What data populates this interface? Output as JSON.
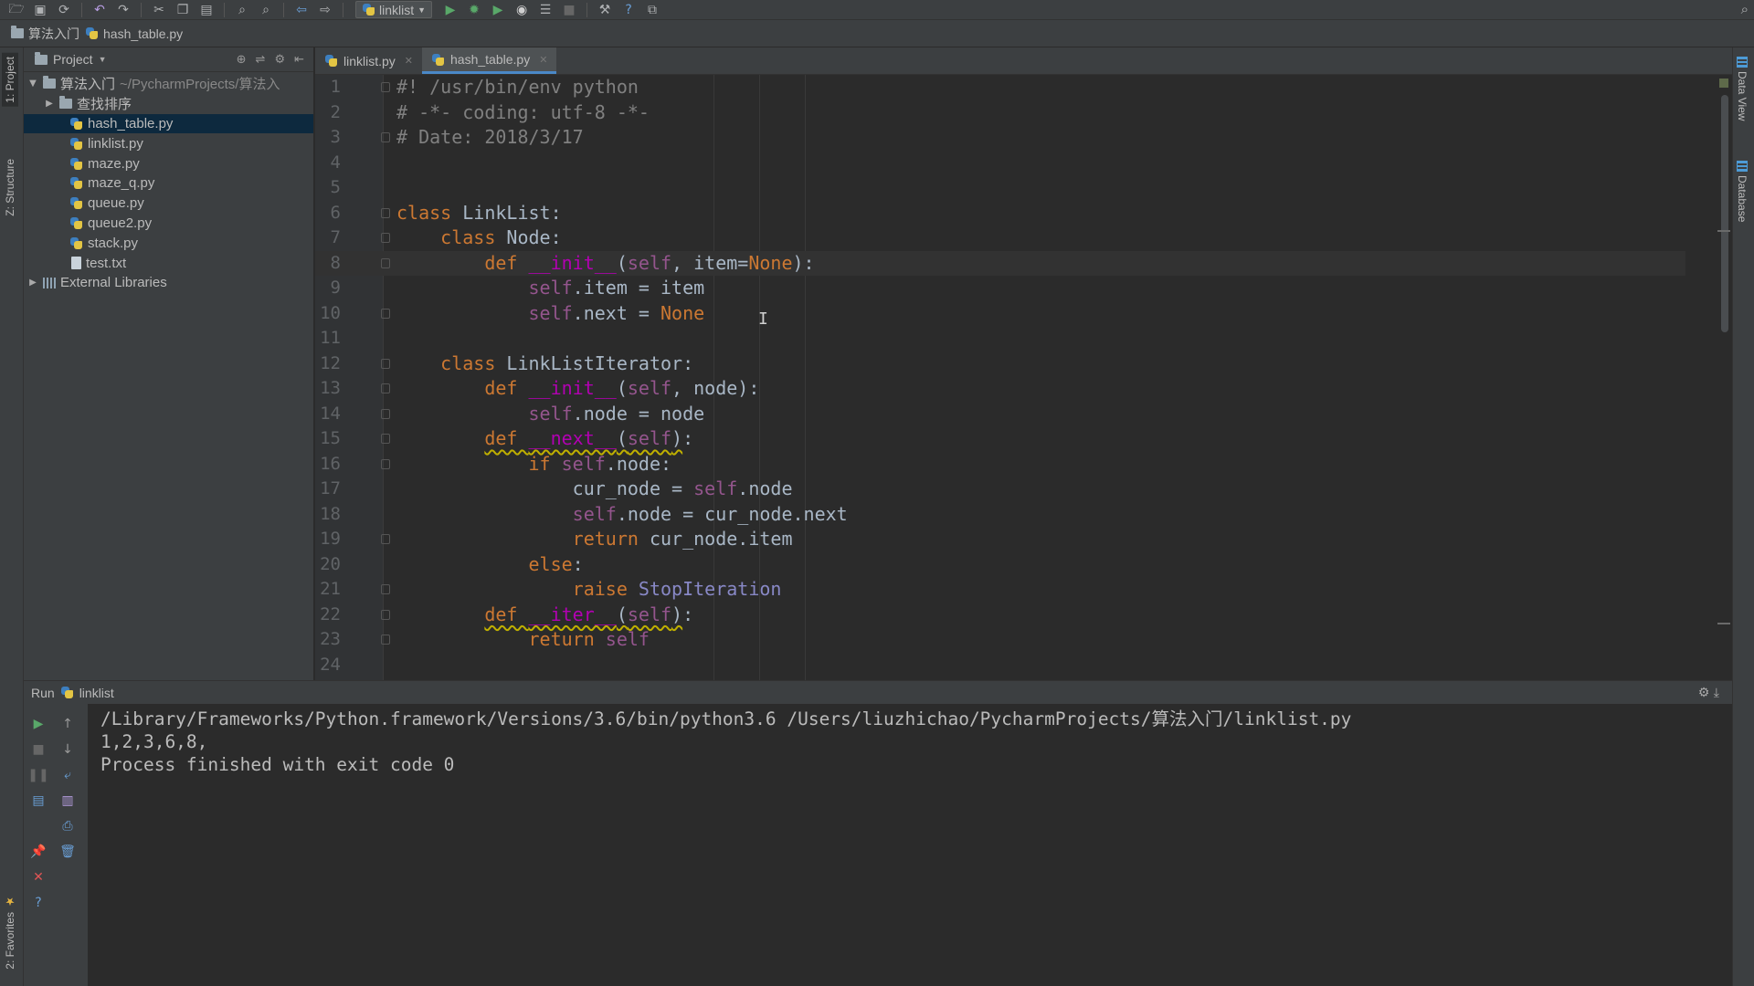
{
  "toolbar": {
    "run_config": "linklist",
    "icons": [
      "open-folder-icon",
      "save-icon",
      "sync-icon",
      "undo-icon",
      "redo-icon",
      "cut-icon",
      "copy-icon",
      "paste-icon",
      "find-icon",
      "replace-icon",
      "back-icon",
      "forward-icon",
      "run-icon",
      "debug-icon",
      "coverage-icon",
      "profile-icon",
      "concurrency-icon",
      "stop-icon",
      "settings-icon",
      "help-icon",
      "vcs-icon",
      "search-icon"
    ]
  },
  "breadcrumb": [
    "算法入门",
    "hash_table.py"
  ],
  "left_strip": {
    "project_tab": "1: Project",
    "structure_tab": "Z: Structure",
    "favorites_tab": "2: Favorites"
  },
  "right_strip": {
    "dataview_tab": "Data View",
    "database_tab": "Database"
  },
  "project_panel": {
    "header": "Project",
    "root_name": "算法入门",
    "root_path": "~/PycharmProjects/算法入",
    "folder": "查找排序",
    "files": [
      "hash_table.py",
      "linklist.py",
      "maze.py",
      "maze_q.py",
      "queue.py",
      "queue2.py",
      "stack.py",
      "test.txt"
    ],
    "external": "External Libraries"
  },
  "editor": {
    "tabs": [
      {
        "label": "linklist.py",
        "active": false
      },
      {
        "label": "hash_table.py",
        "active": true
      }
    ],
    "line_numbers": [
      "1",
      "2",
      "3",
      "4",
      "5",
      "6",
      "7",
      "8",
      "9",
      "10",
      "11",
      "12",
      "13",
      "14",
      "15",
      "16",
      "17",
      "18",
      "19",
      "20",
      "21",
      "22",
      "23",
      "24"
    ],
    "lines": [
      [
        [
          "cm",
          "#! /usr/bin/env python"
        ]
      ],
      [
        [
          "cm",
          "# -*- coding: utf-8 -*-"
        ]
      ],
      [
        [
          "cm",
          "# Date: 2018/3/17"
        ]
      ],
      [],
      [],
      [
        [
          "kw",
          "class "
        ],
        [
          "plain",
          "LinkList:"
        ]
      ],
      [
        [
          "plain",
          "    "
        ],
        [
          "kw",
          "class "
        ],
        [
          "plain",
          "Node:"
        ]
      ],
      [
        [
          "plain",
          "        "
        ],
        [
          "kw",
          "def "
        ],
        [
          "fn",
          "__init__"
        ],
        [
          "plain",
          "("
        ],
        [
          "self",
          "self"
        ],
        [
          "plain",
          ", item="
        ],
        [
          "none",
          "None"
        ],
        [
          "plain",
          "):"
        ]
      ],
      [
        [
          "plain",
          "            "
        ],
        [
          "self",
          "self"
        ],
        [
          "plain",
          ".item = item"
        ]
      ],
      [
        [
          "plain",
          "            "
        ],
        [
          "self",
          "self"
        ],
        [
          "plain",
          ".next = "
        ],
        [
          "none",
          "None"
        ]
      ],
      [],
      [
        [
          "plain",
          "    "
        ],
        [
          "kw",
          "class "
        ],
        [
          "plain",
          "LinkListIterator:"
        ]
      ],
      [
        [
          "plain",
          "        "
        ],
        [
          "kw",
          "def "
        ],
        [
          "fn",
          "__init__"
        ],
        [
          "plain",
          "("
        ],
        [
          "self",
          "self"
        ],
        [
          "plain",
          ", node):"
        ]
      ],
      [
        [
          "plain",
          "            "
        ],
        [
          "self",
          "self"
        ],
        [
          "plain",
          ".node = node"
        ]
      ],
      [
        [
          "plain",
          "        "
        ],
        [
          "wkw",
          "def "
        ],
        [
          "wfn",
          "__next__"
        ],
        [
          "wplain",
          "("
        ],
        [
          "wself",
          "self"
        ],
        [
          "wplain",
          ")"
        ],
        [
          "plain",
          ":"
        ]
      ],
      [
        [
          "plain",
          "            "
        ],
        [
          "kw",
          "if "
        ],
        [
          "self",
          "self"
        ],
        [
          "plain",
          ".node:"
        ]
      ],
      [
        [
          "plain",
          "                cur_node = "
        ],
        [
          "self",
          "self"
        ],
        [
          "plain",
          ".node"
        ]
      ],
      [
        [
          "plain",
          "                "
        ],
        [
          "self",
          "self"
        ],
        [
          "plain",
          ".node = cur_node.next"
        ]
      ],
      [
        [
          "plain",
          "                "
        ],
        [
          "kw",
          "return "
        ],
        [
          "plain",
          "cur_node.item"
        ]
      ],
      [
        [
          "plain",
          "            "
        ],
        [
          "kw",
          "else"
        ],
        [
          "plain",
          ":"
        ]
      ],
      [
        [
          "plain",
          "                "
        ],
        [
          "kw",
          "raise "
        ],
        [
          "builtin",
          "StopIteration"
        ]
      ],
      [
        [
          "plain",
          "        "
        ],
        [
          "wkw",
          "def "
        ],
        [
          "wfn",
          "__iter__"
        ],
        [
          "wplain",
          "("
        ],
        [
          "wself",
          "self"
        ],
        [
          "wplain",
          ")"
        ],
        [
          "plain",
          ":"
        ]
      ],
      [
        [
          "plain",
          "            "
        ],
        [
          "kw",
          "return "
        ],
        [
          "self",
          "self"
        ]
      ],
      []
    ]
  },
  "run_panel": {
    "label": "Run",
    "config": "linklist",
    "output": [
      "/Library/Frameworks/Python.framework/Versions/3.6/bin/python3.6 /Users/liuzhichao/PycharmProjects/算法入门/linklist.py",
      "1,2,3,6,8,",
      "Process finished with exit code 0"
    ]
  },
  "colors": {
    "keyword": "#cc7832",
    "comment": "#808080",
    "self": "#94558d",
    "dunder": "#b200b2",
    "builtin": "#8888c6",
    "text": "#a9b7c6",
    "selection": "#0d293e",
    "background": "#2b2b2b",
    "chrome": "#3c3f41"
  }
}
